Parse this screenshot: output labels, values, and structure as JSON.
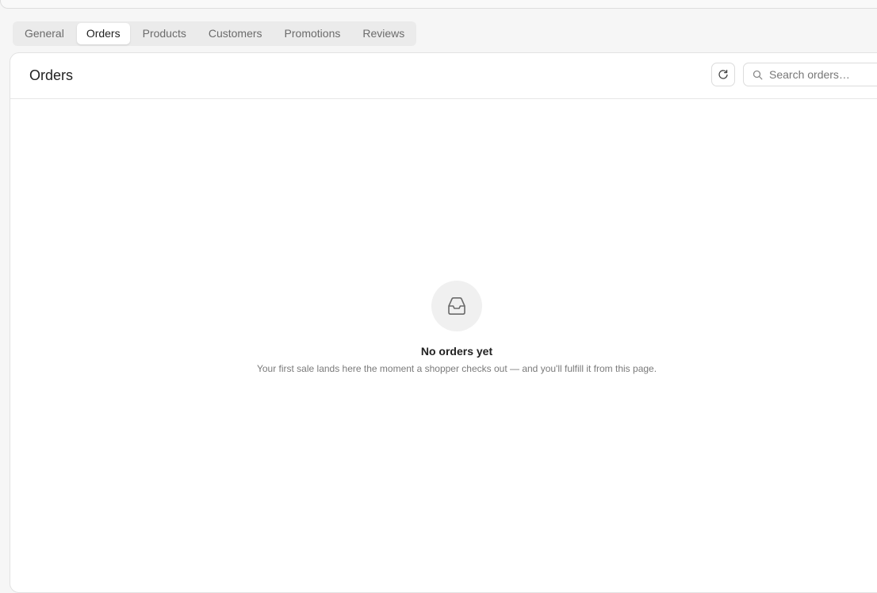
{
  "tabs": [
    {
      "label": "General",
      "active": false
    },
    {
      "label": "Orders",
      "active": true
    },
    {
      "label": "Products",
      "active": false
    },
    {
      "label": "Customers",
      "active": false
    },
    {
      "label": "Promotions",
      "active": false
    },
    {
      "label": "Reviews",
      "active": false
    }
  ],
  "panel": {
    "title": "Orders",
    "refresh_icon": "refresh-icon",
    "search": {
      "icon": "search-icon",
      "placeholder": "Search orders…",
      "value": ""
    }
  },
  "empty_state": {
    "icon": "inbox-icon",
    "title": "No orders yet",
    "description": "Your first sale lands here the moment a shopper checks out — and you'll fulfill it from this page."
  },
  "colors": {
    "background": "#f6f6f6",
    "panel": "#ffffff",
    "tab_bar": "#ebebeb",
    "muted_text": "#7a7a7a"
  }
}
